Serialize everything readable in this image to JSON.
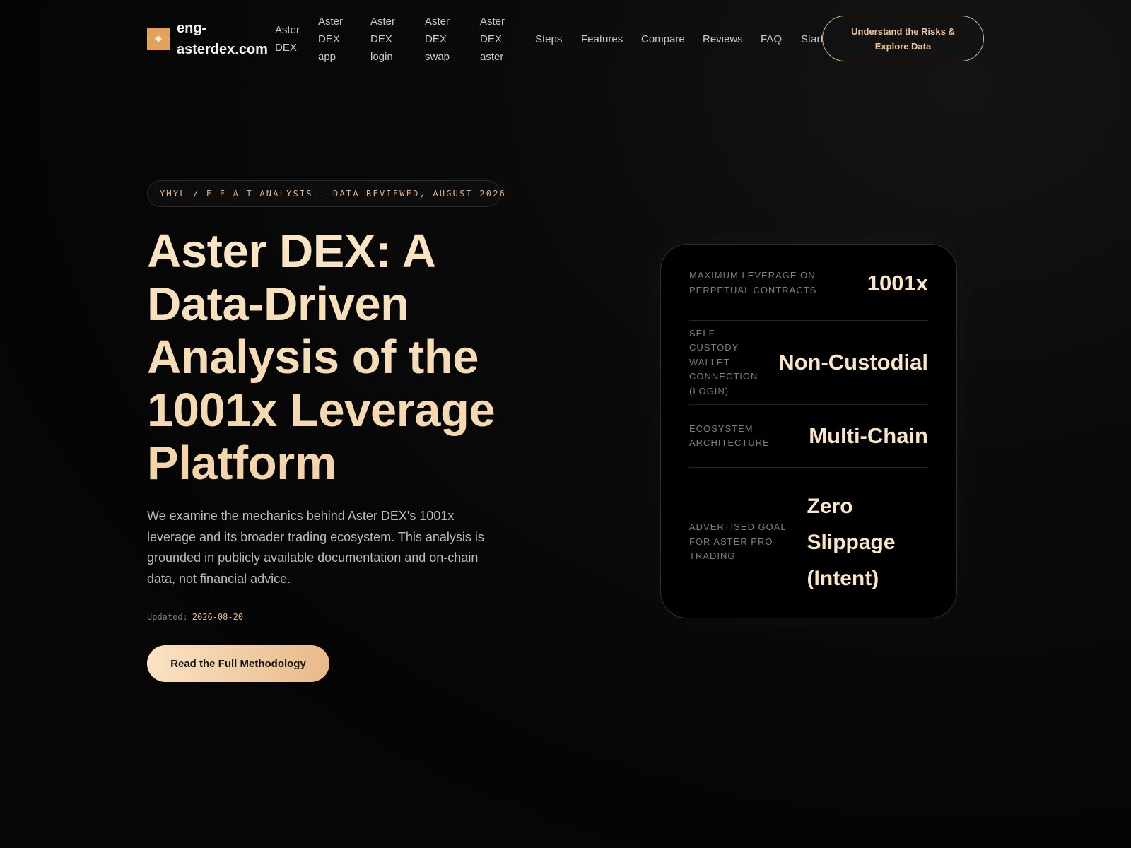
{
  "header": {
    "brand": "eng-asterdex.com",
    "nav": [
      {
        "label": "Aster DEX"
      },
      {
        "label": "Aster DEX app"
      },
      {
        "label": "Aster DEX login"
      },
      {
        "label": "Aster DEX swap"
      },
      {
        "label": "Aster DEX aster"
      },
      {
        "label": "Steps"
      },
      {
        "label": "Features"
      },
      {
        "label": "Compare"
      },
      {
        "label": "Reviews"
      },
      {
        "label": "FAQ"
      },
      {
        "label": "Start"
      }
    ],
    "cta": "Understand the Risks & Explore Data"
  },
  "hero": {
    "badge": "YMYL / E-E-A-T ANALYSIS — DATA REVIEWED, AUGUST 2026",
    "title": "Aster DEX: A Data-Driven Analysis of the 1001x Leverage Platform",
    "description": "We examine the mechanics behind Aster DEX's 1001x leverage and its broader trading ecosystem. This analysis is grounded in publicly available documentation and on-chain data, not financial advice.",
    "updated_label": "Updated:",
    "updated_date": "2026-08-20",
    "cta": "Read the Full Methodology"
  },
  "stats": [
    {
      "label": "Maximum leverage on perpetual contracts",
      "value": "1001x"
    },
    {
      "label": "Self-custody wallet connection (login)",
      "value": "Non-Custodial"
    },
    {
      "label": "Ecosystem architecture",
      "value": "Multi-Chain"
    },
    {
      "label": "Advertised goal for Aster Pro trading",
      "value": "Zero Slippage (Intent)"
    }
  ],
  "colors": {
    "accent": "#e8b886",
    "accent_light": "#fbe3c3",
    "background": "#050505"
  }
}
